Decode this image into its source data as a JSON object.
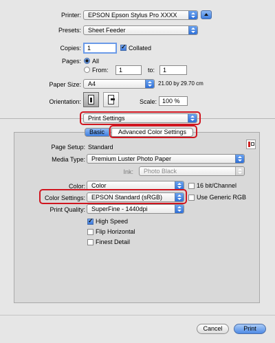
{
  "printer": {
    "label": "Printer:",
    "value": "EPSON Epson Stylus Pro XXXX"
  },
  "presets": {
    "label": "Presets:",
    "value": "Sheet Feeder"
  },
  "copies": {
    "label": "Copies:",
    "value": "1",
    "collated_label": "Collated"
  },
  "pages": {
    "label": "Pages:",
    "all_label": "All",
    "from_label": "From:",
    "from_value": "1",
    "to_label": "to:",
    "to_value": "1"
  },
  "paper_size": {
    "label": "Paper Size:",
    "value": "A4",
    "dimensions": "21.00 by 29.70 cm"
  },
  "orientation": {
    "label": "Orientation:",
    "scale_label": "Scale:",
    "scale_value": "100 %"
  },
  "panel_menu": {
    "value": "Print Settings"
  },
  "tabs": [
    {
      "label": "Basic"
    },
    {
      "label": "Advanced Color Settings"
    }
  ],
  "settings": {
    "page_setup_label": "Page Setup:",
    "page_setup_value": "Standard",
    "media_type_label": "Media Type:",
    "media_type_value": "Premium Luster Photo Paper",
    "ink_label": "Ink:",
    "ink_value": "Photo Black",
    "color_label": "Color:",
    "color_value": "Color",
    "bit16_label": "16 bit/Channel",
    "color_settings_label": "Color Settings:",
    "color_settings_value": "EPSON Standard (sRGB)",
    "generic_rgb_label": "Use Generic RGB",
    "print_quality_label": "Print Quality:",
    "print_quality_value": "SuperFine - 1440dpi",
    "high_speed_label": "High Speed",
    "flip_label": "Flip Horizontal",
    "finest_label": "Finest Detail"
  },
  "footer": {
    "cancel_label": "Cancel",
    "print_label": "Print"
  },
  "colors": {
    "highlight": "#d0151f",
    "accent": "#3a78dd"
  }
}
